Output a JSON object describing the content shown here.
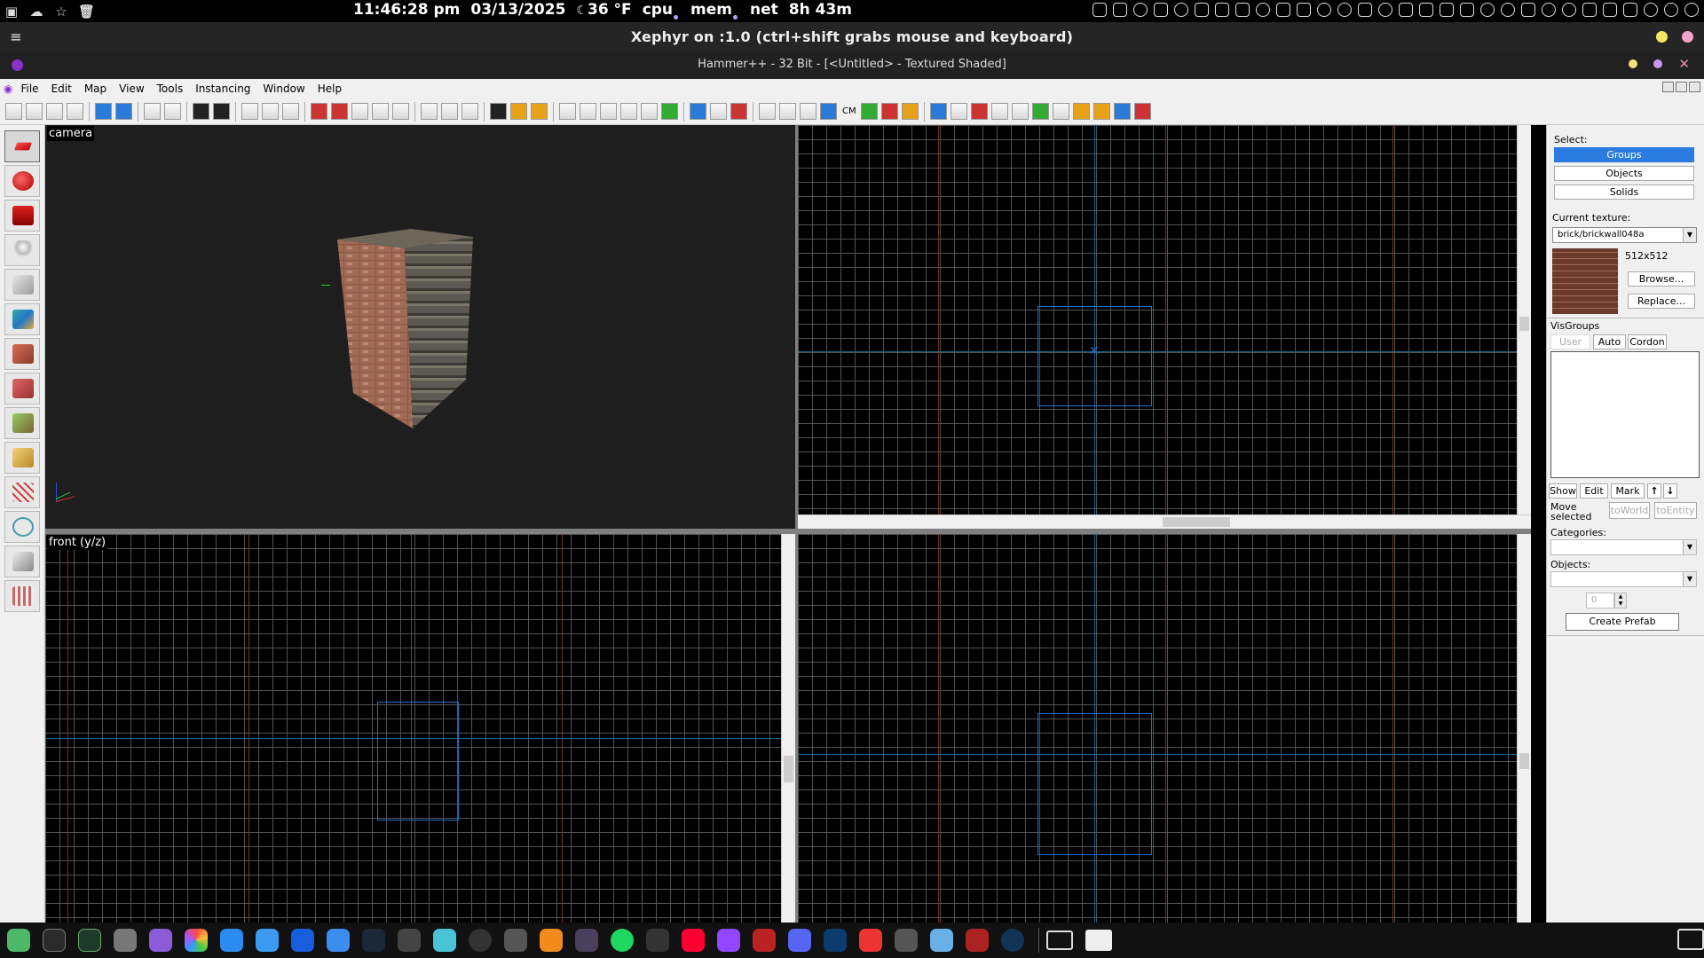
{
  "sysbar": {
    "time": "11:46:28 pm",
    "date": "03/13/2025",
    "weather": "36 °F",
    "cpu_label": "cpu",
    "mem_label": "mem",
    "net_label": "net",
    "uptime": "8h 43m",
    "icons": [
      "logo-icon",
      "cloud-icon",
      "star-icon",
      "trash-icon"
    ]
  },
  "xephyr": {
    "title": "Xephyr on :1.0 (ctrl+shift grabs mouse and keyboard)",
    "menu_icon": "hamburger-icon",
    "dot_colors": [
      "#f5e663",
      "#f5a3c8"
    ]
  },
  "hammer": {
    "title": "Hammer++ - 32 Bit - [<Untitled> - Textured Shaded]",
    "accent": "#8b2fc9"
  },
  "menubar": {
    "items": [
      "File",
      "Edit",
      "Map",
      "View",
      "Tools",
      "Instancing",
      "Window",
      "Help"
    ]
  },
  "toolbar": {
    "cm_label": "CM"
  },
  "viewports": {
    "camera_label": "camera",
    "front_label": "front (y/z)"
  },
  "panel": {
    "select_label": "Select:",
    "select_buttons": [
      "Groups",
      "Objects",
      "Solids"
    ],
    "selected_button": "Groups",
    "current_texture_label": "Current texture:",
    "current_texture": "brick/brickwall048a",
    "texture_size": "512x512",
    "browse_label": "Browse...",
    "replace_label": "Replace...",
    "visgroups_label": "VisGroups",
    "visgroup_tabs": [
      "User",
      "Auto",
      "Cordon"
    ],
    "vis_buttons": [
      "Show",
      "Edit",
      "Mark"
    ],
    "move_selected_label": "Move selected",
    "to_world_label": "toWorld",
    "to_entity_label": "toEntity",
    "categories_label": "Categories:",
    "objects_label": "Objects:",
    "count_value": "0",
    "create_prefab_label": "Create Prefab"
  },
  "colors": {
    "select_accent": "#2b7be0",
    "grid_line": "#5f5f5f",
    "selection_box": "#1f6fd0"
  }
}
